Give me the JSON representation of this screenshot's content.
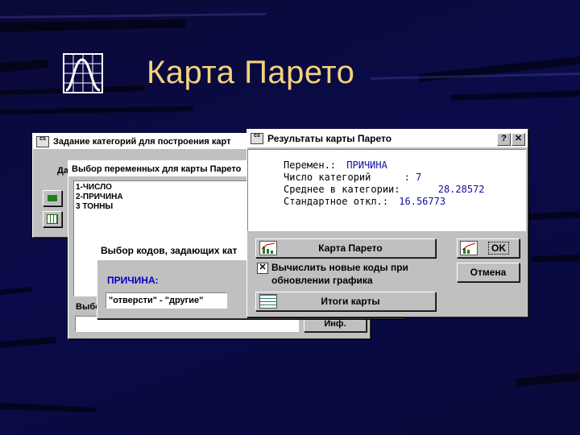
{
  "slide": {
    "title": "Карта Парето"
  },
  "dialog1": {
    "title": "Задание категорий для построения карт",
    "label_fragment": "Да"
  },
  "dialog2": {
    "title": "Выбор переменных для карты Парето",
    "variables": [
      "1-ЧИСЛО",
      "2-ПРИЧИНА",
      "3 ТОННЫ"
    ],
    "bottom_label": "Выбо",
    "info_button": "Инф."
  },
  "dialog3": {
    "title": "Выбор кодов, задающих кат",
    "var_label": "ПРИЧИНА:",
    "codes_value": "\"отверсти\" - \"другие\""
  },
  "results": {
    "title": "Результаты карты Парето",
    "help_btn": "?",
    "close_btn": "✕",
    "lines": [
      {
        "label": "Перемен.:",
        "value": "ПРИЧИНА"
      },
      {
        "label": "Число категорий",
        "value": ": 7"
      },
      {
        "label": "Среднее в категории:",
        "value": "28.28572"
      },
      {
        "label": "Стандартное откл.:",
        "value": "16.56773"
      }
    ],
    "pareto_btn": "Карта Парето",
    "ok_btn": "OK",
    "cancel_btn": "Отмена",
    "checkbox_label_1": "Вычислить новые коды при",
    "checkbox_label_2": "обновлении графика",
    "checkbox_checked": true,
    "totals_btn": "Итоги карты",
    "value_color": "#1010a0"
  }
}
